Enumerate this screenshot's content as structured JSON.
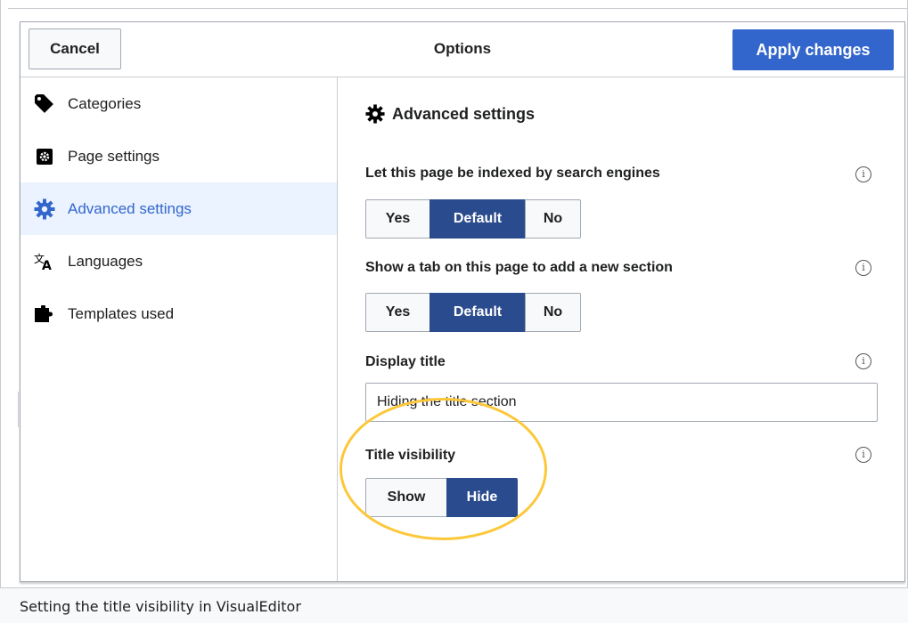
{
  "dialog": {
    "title": "Options",
    "cancel_label": "Cancel",
    "apply_label": "Apply changes"
  },
  "sidebar": {
    "items": [
      {
        "label": "Categories",
        "icon": "tag-icon",
        "active": false
      },
      {
        "label": "Page settings",
        "icon": "page-settings-icon",
        "active": false
      },
      {
        "label": "Advanced settings",
        "icon": "gear-icon",
        "active": true
      },
      {
        "label": "Languages",
        "icon": "language-icon",
        "active": false
      },
      {
        "label": "Templates used",
        "icon": "puzzle-icon",
        "active": false
      }
    ]
  },
  "panel": {
    "heading": "Advanced settings",
    "indexing": {
      "label": "Let this page be indexed by search engines",
      "options": [
        "Yes",
        "Default",
        "No"
      ],
      "selected": "Default"
    },
    "new_section_tab": {
      "label": "Show a tab on this page to add a new section",
      "options": [
        "Yes",
        "Default",
        "No"
      ],
      "selected": "Default"
    },
    "display_title": {
      "label": "Display title",
      "value": "Hiding the title section"
    },
    "title_visibility": {
      "label": "Title visibility",
      "options": [
        "Show",
        "Hide"
      ],
      "selected": "Hide"
    },
    "info_glyph": "i"
  },
  "caption": "Setting the title visibility in VisualEditor",
  "colors": {
    "accent": "#3366cc",
    "selected_segment": "#2a4b8d",
    "active_nav_bg": "#eaf3ff",
    "highlight": "#fcc83a"
  }
}
